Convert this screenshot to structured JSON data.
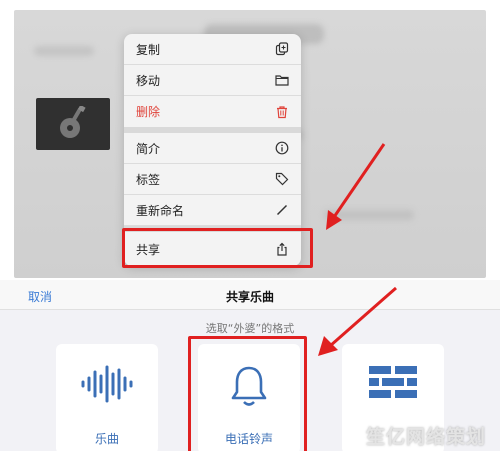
{
  "menu": {
    "items": [
      {
        "label": "复制",
        "icon": "copy-icon"
      },
      {
        "label": "移动",
        "icon": "folder-icon"
      },
      {
        "label": "删除",
        "icon": "trash-icon",
        "color": "#e0433a"
      },
      {
        "label": "简介",
        "icon": "info-icon"
      },
      {
        "label": "标签",
        "icon": "tag-icon"
      },
      {
        "label": "重新命名",
        "icon": "pencil-icon"
      },
      {
        "label": "共享",
        "icon": "share-icon"
      }
    ]
  },
  "sheet": {
    "cancel_label": "取消",
    "title": "共享乐曲",
    "subtitle": "选取“外婆”的格式",
    "options": [
      {
        "label": "乐曲",
        "icon": "waveform-icon"
      },
      {
        "label": "电话铃声",
        "icon": "bell-icon"
      },
      {
        "label": "",
        "icon": "brick-icon"
      }
    ]
  },
  "watermark": "笙亿网络策划",
  "colors": {
    "accent": "#3b6fb6",
    "highlight": "#e02020",
    "danger": "#e0433a"
  }
}
